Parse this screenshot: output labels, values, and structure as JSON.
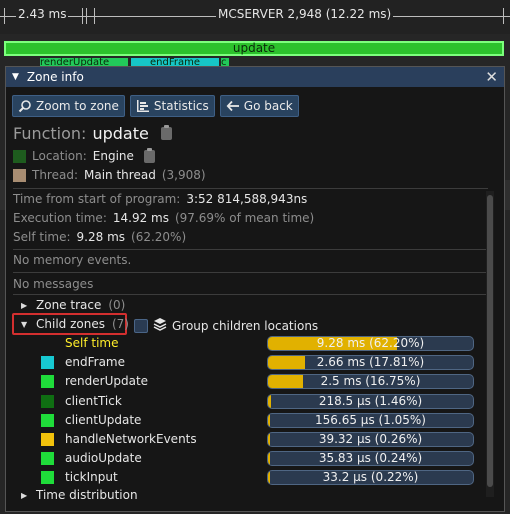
{
  "timeline": {
    "ruler_left_label": "2.43 ms",
    "ruler_center_label": "MCSERVER 2,948 (12.22 ms)",
    "zone_bar_label": "update",
    "mini_bars": [
      {
        "label": "renderUpdate",
        "color": "#22c95a"
      },
      {
        "label": "endFrame",
        "color": "#16c6c6"
      },
      {
        "label": "c",
        "color": "#22c95a"
      }
    ]
  },
  "window": {
    "title": "Zone info",
    "collapse_icon": "triangle-down-icon",
    "close_label": "✕"
  },
  "toolbar": {
    "zoom_label": "Zoom to zone",
    "statistics_label": "Statistics",
    "back_label": "Go back"
  },
  "function": {
    "label": "Function:",
    "value": "update"
  },
  "location": {
    "label": "Location:",
    "value": "Engine",
    "color": "#1e5c1e"
  },
  "thread": {
    "label": "Thread:",
    "value": "Main thread",
    "id": "(3,908)",
    "color": "#a88d72"
  },
  "stats": {
    "time_from_start_label": "Time from start of program:",
    "time_from_start_value": "3:52 814,588,943ns",
    "execution_label": "Execution time:",
    "execution_value": "14.92 ms",
    "execution_pct": "(97.69% of mean time)",
    "self_label": "Self time:",
    "self_value": "9.28 ms",
    "self_pct": "(62.20%)"
  },
  "messages": {
    "memory": "No memory events.",
    "messages": "No messages"
  },
  "sections": {
    "zone_trace": {
      "label": "Zone trace",
      "count": "(0)"
    },
    "child_zones": {
      "label": "Child zones",
      "count": "(7)"
    },
    "group_children": "Group children locations",
    "time_distribution": "Time distribution"
  },
  "children": [
    {
      "name": "Self time",
      "value": "9.28 ms (62.20%)",
      "fraction": 0.622,
      "color": "",
      "highlight": true
    },
    {
      "name": "endFrame",
      "value": "2.66 ms (17.81%)",
      "fraction": 0.178,
      "color": "#17c9d2",
      "highlight": false
    },
    {
      "name": "renderUpdate",
      "value": "2.5 ms (16.75%)",
      "fraction": 0.1675,
      "color": "#1fdc3a",
      "highlight": false
    },
    {
      "name": "clientTick",
      "value": "218.5 μs (1.46%)",
      "fraction": 0.0146,
      "color": "#0f6e12",
      "highlight": false
    },
    {
      "name": "clientUpdate",
      "value": "156.65 μs (1.05%)",
      "fraction": 0.0105,
      "color": "#1fdc3a",
      "highlight": false
    },
    {
      "name": "handleNetworkEvents",
      "value": "39.32 μs (0.26%)",
      "fraction": 0.0026,
      "color": "#f2c20c",
      "highlight": false
    },
    {
      "name": "audioUpdate",
      "value": "35.83 μs (0.24%)",
      "fraction": 0.0024,
      "color": "#1fdc3a",
      "highlight": false
    },
    {
      "name": "tickInput",
      "value": "33.2 μs (0.22%)",
      "fraction": 0.0022,
      "color": "#1fdc3a",
      "highlight": false
    }
  ],
  "colors": {
    "accent": "#29435f",
    "bar_fill": "#e1b100",
    "highlight_text": "#ffee2a",
    "child_zone_outline": "#d32f2f"
  }
}
